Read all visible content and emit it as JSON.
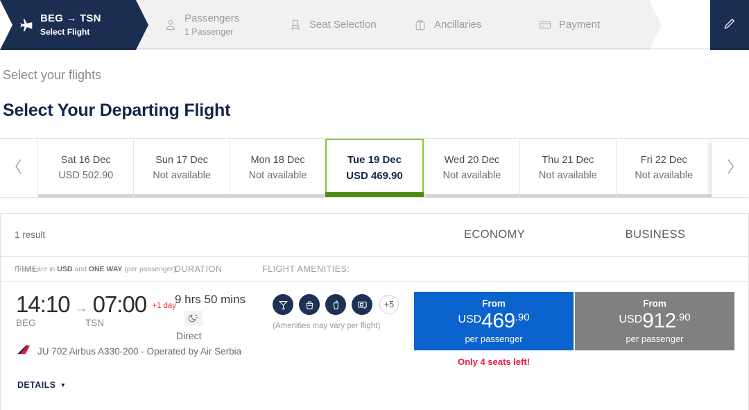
{
  "stepbar": {
    "steps": [
      {
        "icon": "plane-icon",
        "title": "BEG → TSN",
        "sub": "Select Flight",
        "active": true
      },
      {
        "icon": "passenger-icon",
        "title": "Passengers",
        "sub": "1 Passenger",
        "active": false
      },
      {
        "icon": "seat-icon",
        "title": "Seat Selection",
        "sub": "",
        "active": false
      },
      {
        "icon": "suitcase-icon",
        "title": "Ancillaries",
        "sub": "",
        "active": false
      },
      {
        "icon": "credit-card-icon",
        "title": "Payment",
        "sub": "",
        "active": false
      }
    ],
    "edit_button": "edit-pencil-icon",
    "accent_color": "#1a2e51"
  },
  "headings": {
    "eyebrow": "Select your flights",
    "title": "Select Your Departing Flight"
  },
  "date_strip": {
    "prev_label": "‹",
    "next_label": "›",
    "tiles": [
      {
        "date": "Sat 16 Dec",
        "price": "USD 502.90",
        "selected": false
      },
      {
        "date": "Sun 17 Dec",
        "price": "Not available",
        "selected": false
      },
      {
        "date": "Mon 18 Dec",
        "price": "Not available",
        "selected": false
      },
      {
        "date": "Tue 19 Dec",
        "price": "USD 469.90",
        "selected": true
      },
      {
        "date": "Wed 20 Dec",
        "price": "Not available",
        "selected": false
      },
      {
        "date": "Thu 21 Dec",
        "price": "Not available",
        "selected": false
      },
      {
        "date": "Fri 22 Dec",
        "price": "Not available",
        "selected": false
      }
    ],
    "selected_border_color": "#8cc63e",
    "selected_underline_color": "#4e8b10"
  },
  "results": {
    "count_label": "1 result",
    "cabins": {
      "economy": "ECONOMY",
      "business": "BUSINESS"
    },
    "columns": {
      "time": "TIME",
      "duration": "DURATION",
      "amenities": "FLIGHT AMENITIES:",
      "note_prefix": "Prices are in ",
      "note_bold1": "USD",
      "note_mid": " and ",
      "note_bold2": "ONE WAY",
      "note_suffix": " (per passenger)"
    },
    "flight": {
      "depart_time": "14:10",
      "arrive_time": "07:00",
      "arrow": "→",
      "day_offset": "+1 day",
      "depart_code": "BEG",
      "arrive_code": "TSN",
      "duration": "9 hrs 50 mins",
      "overnight_icon": "moon-stars-icon",
      "stops": "Direct",
      "amenity_icons": [
        "cocktail-icon",
        "meal-icon",
        "beverage-icon",
        "entertainment-screen-icon"
      ],
      "amenities_more": "+5",
      "amenities_note": "(Amenities may vary per flight)",
      "airline_logo": "air-serbia-tail-logo",
      "airline_info": "JU 702 Airbus A330-200 - Operated by Air Serbia",
      "details_label": "DETAILS",
      "details_caret": "▼",
      "economy": {
        "from_label": "From",
        "currency": "USD",
        "amount": "469",
        "decimals": ".90",
        "per": "per passenger",
        "color": "#0b63ce"
      },
      "business": {
        "from_label": "From",
        "currency": "USD",
        "amount": "912",
        "decimals": ".90",
        "per": "per passenger",
        "color": "#808080"
      },
      "seats_warning": "Only 4 seats left!",
      "seats_warning_color": "#e8173d"
    }
  }
}
